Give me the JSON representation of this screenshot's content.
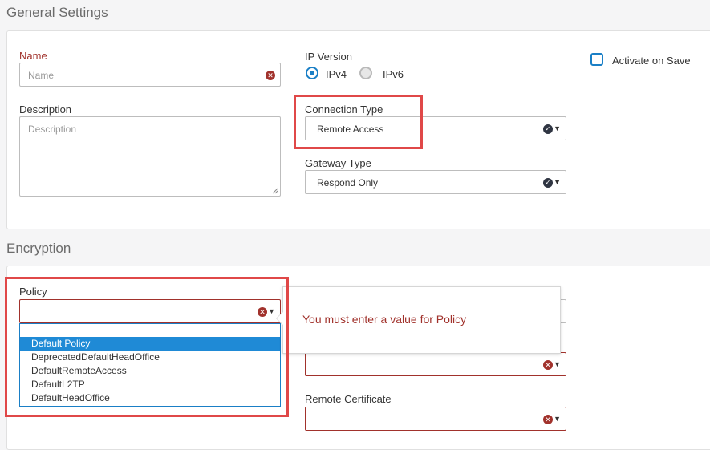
{
  "general": {
    "title": "General Settings",
    "name_label": "Name",
    "name_placeholder": "Name",
    "description_label": "Description",
    "description_placeholder": "Description",
    "ip_version_label": "IP Version",
    "ipv4_label": "IPv4",
    "ipv6_label": "IPv6",
    "ip_version_selected": "IPv4",
    "activate_label": "Activate on Save",
    "connection_type_label": "Connection Type",
    "connection_type_value": "Remote Access",
    "gateway_type_label": "Gateway Type",
    "gateway_type_value": "Respond Only"
  },
  "encryption": {
    "title": "Encryption",
    "policy_label": "Policy",
    "policy_value": "",
    "policy_options": [
      "Default Policy",
      "DeprecatedDefaultHeadOffice",
      "DefaultRemoteAccess",
      "DefaultL2TP",
      "DefaultHeadOffice"
    ],
    "policy_highlighted_option": "Default Policy",
    "validation_message": "You must enter a value for Policy",
    "remote_certificate_label": "Remote Certificate",
    "remote_certificate_value": ""
  },
  "colors": {
    "accent": "#1a7fc6",
    "error": "#a1322c",
    "highlight": "#e04848",
    "selected_option": "#1f8ad6"
  },
  "icons": {
    "clear": "clear-x-icon",
    "valid": "check-circle-icon",
    "dropdown": "chevron-down-icon"
  }
}
